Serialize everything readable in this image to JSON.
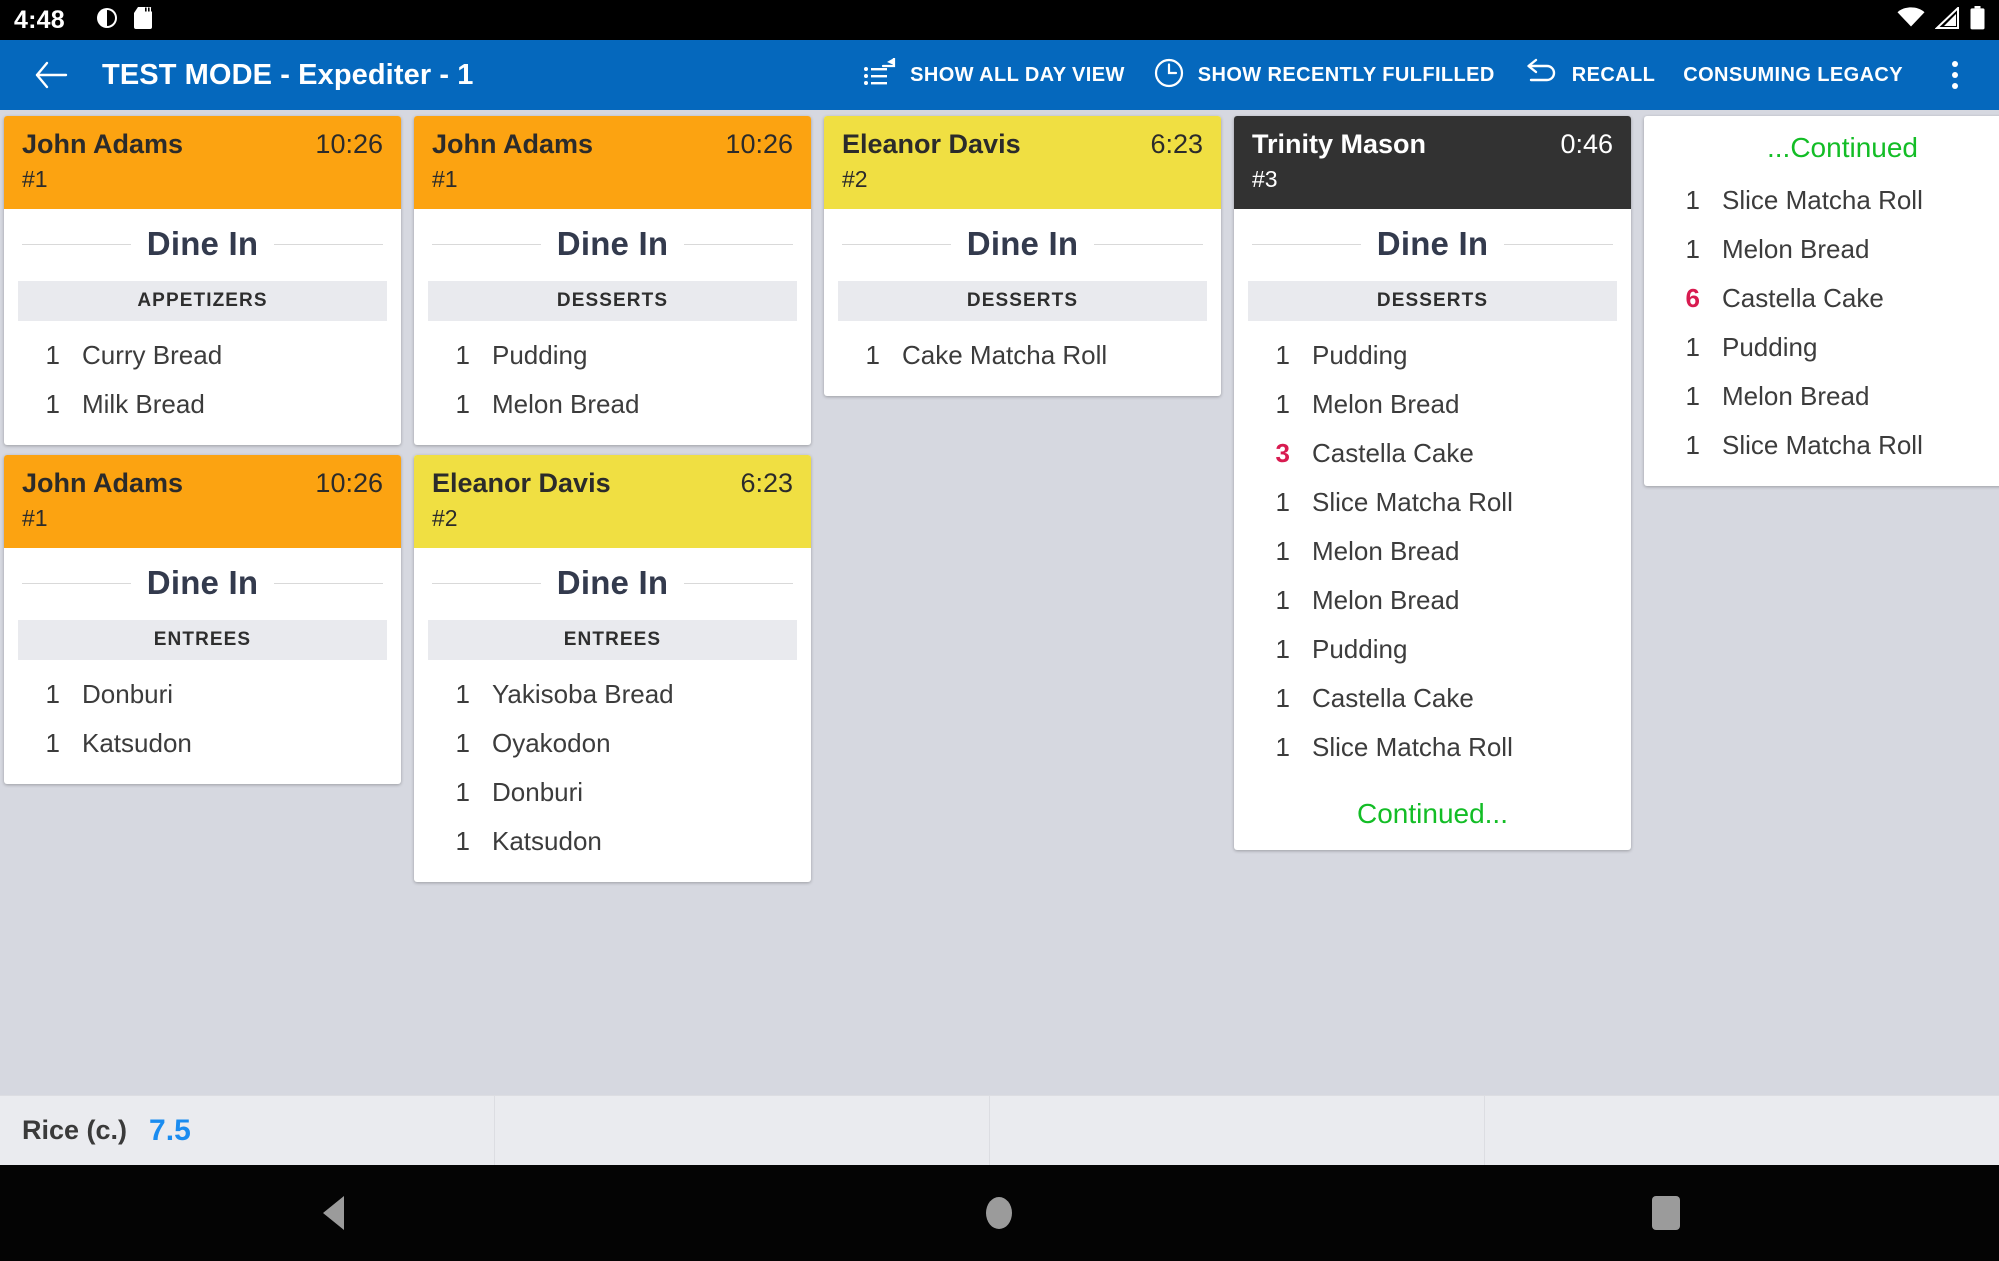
{
  "status_bar": {
    "clock": "4:48",
    "left_icons": [
      "do-not-disturb-icon",
      "sd-card-icon"
    ],
    "right_icons": [
      "wifi-icon",
      "cell-signal-icon",
      "battery-icon"
    ]
  },
  "app_bar": {
    "back_icon": "back-arrow-icon",
    "title": "TEST MODE - Expediter - 1",
    "accent_color": "#0568bd",
    "actions": [
      {
        "icon": "list-expand-icon",
        "label": "SHOW ALL DAY VIEW"
      },
      {
        "icon": "clock-icon",
        "label": "SHOW RECENTLY FULFILLED"
      },
      {
        "icon": "undo-icon",
        "label": "RECALL"
      },
      {
        "icon": null,
        "label": "CONSUMING LEGACY"
      }
    ],
    "overflow_icon": "more-vertical-icon"
  },
  "colors": {
    "header_orange": "#fca311",
    "header_yellow": "#f0df42",
    "header_dark": "#323232",
    "quantity_highlight": "#d81b50",
    "continued_green": "#13bd26",
    "summary_value": "#1a8cf0",
    "board_background": "#d6d8e0"
  },
  "board": {
    "columns": [
      {
        "tickets": [
          {
            "customer": "John Adams",
            "timer": "10:26",
            "table": "#1",
            "header_style": "orange",
            "order_type": "Dine In",
            "course": "APPETIZERS",
            "items": [
              {
                "qty": "1",
                "name": "Curry Bread",
                "highlight": false
              },
              {
                "qty": "1",
                "name": "Milk Bread",
                "highlight": false
              }
            ]
          },
          {
            "customer": "John Adams",
            "timer": "10:26",
            "table": "#1",
            "header_style": "orange",
            "order_type": "Dine In",
            "course": "ENTREES",
            "items": [
              {
                "qty": "1",
                "name": "Donburi",
                "highlight": false
              },
              {
                "qty": "1",
                "name": "Katsudon",
                "highlight": false
              }
            ]
          }
        ]
      },
      {
        "tickets": [
          {
            "customer": "John Adams",
            "timer": "10:26",
            "table": "#1",
            "header_style": "orange",
            "order_type": "Dine In",
            "course": "DESSERTS",
            "items": [
              {
                "qty": "1",
                "name": "Pudding",
                "highlight": false
              },
              {
                "qty": "1",
                "name": "Melon Bread",
                "highlight": false
              }
            ]
          },
          {
            "customer": "Eleanor Davis",
            "timer": "6:23",
            "table": "#2",
            "header_style": "yellow",
            "order_type": "Dine In",
            "course": "ENTREES",
            "items": [
              {
                "qty": "1",
                "name": "Yakisoba Bread",
                "highlight": false
              },
              {
                "qty": "1",
                "name": "Oyakodon",
                "highlight": false
              },
              {
                "qty": "1",
                "name": "Donburi",
                "highlight": false
              },
              {
                "qty": "1",
                "name": "Katsudon",
                "highlight": false
              }
            ]
          }
        ]
      },
      {
        "tickets": [
          {
            "customer": "Eleanor Davis",
            "timer": "6:23",
            "table": "#2",
            "header_style": "yellow",
            "order_type": "Dine In",
            "course": "DESSERTS",
            "items": [
              {
                "qty": "1",
                "name": "Cake Matcha Roll",
                "highlight": false
              }
            ]
          }
        ]
      },
      {
        "tickets": [
          {
            "customer": "Trinity Mason",
            "timer": "0:46",
            "table": "#3",
            "header_style": "dark",
            "order_type": "Dine In",
            "course": "DESSERTS",
            "items": [
              {
                "qty": "1",
                "name": "Pudding",
                "highlight": false
              },
              {
                "qty": "1",
                "name": "Melon Bread",
                "highlight": false
              },
              {
                "qty": "3",
                "name": "Castella Cake",
                "highlight": true
              },
              {
                "qty": "1",
                "name": "Slice Matcha Roll",
                "highlight": false
              },
              {
                "qty": "1",
                "name": "Melon Bread",
                "highlight": false
              },
              {
                "qty": "1",
                "name": "Melon Bread",
                "highlight": false
              },
              {
                "qty": "1",
                "name": "Pudding",
                "highlight": false
              },
              {
                "qty": "1",
                "name": "Castella Cake",
                "highlight": false
              },
              {
                "qty": "1",
                "name": "Slice Matcha Roll",
                "highlight": false
              }
            ],
            "footer_continued": "Continued..."
          }
        ]
      },
      {
        "tickets": [
          {
            "header_continued": "...Continued",
            "items": [
              {
                "qty": "1",
                "name": "Slice Matcha Roll",
                "highlight": false
              },
              {
                "qty": "1",
                "name": "Melon Bread",
                "highlight": false
              },
              {
                "qty": "6",
                "name": "Castella Cake",
                "highlight": true
              },
              {
                "qty": "1",
                "name": "Pudding",
                "highlight": false
              },
              {
                "qty": "1",
                "name": "Melon Bread",
                "highlight": false
              },
              {
                "qty": "1",
                "name": "Slice Matcha Roll",
                "highlight": false
              }
            ]
          }
        ]
      }
    ]
  },
  "summary": {
    "cells": [
      {
        "key": "Rice (c.)",
        "value": "7.5"
      },
      {
        "key": "",
        "value": ""
      },
      {
        "key": "",
        "value": ""
      },
      {
        "key": "",
        "value": ""
      }
    ]
  },
  "nav_bar": {
    "back_icon": "nav-back-icon",
    "home_icon": "nav-home-icon",
    "recents_icon": "nav-recents-icon"
  }
}
